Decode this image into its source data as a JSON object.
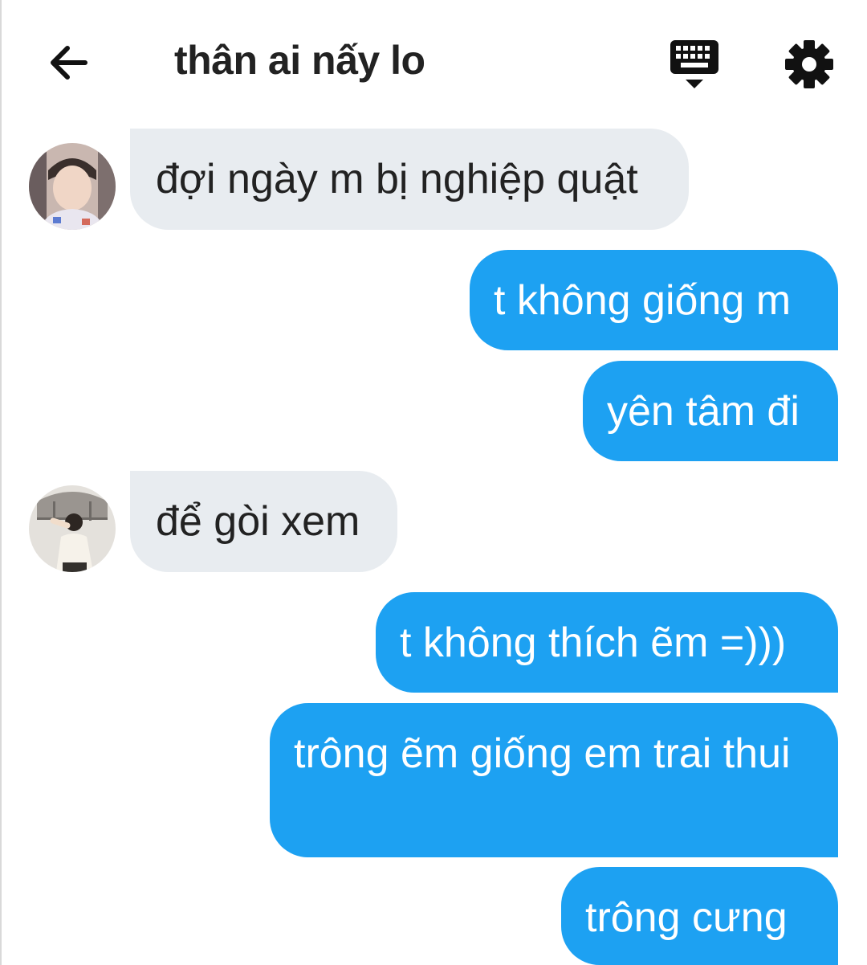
{
  "header": {
    "title": "thân ai nấy lo",
    "back_icon": "back-arrow-icon",
    "keyboard_icon": "keyboard-icon",
    "settings_icon": "gear-icon"
  },
  "messages": [
    {
      "direction": "incoming",
      "text": "đợi ngày m bị nghiệp quật",
      "avatar": "contact-avatar"
    },
    {
      "direction": "outgoing",
      "text": "t không giống m"
    },
    {
      "direction": "outgoing",
      "text": "yên tâm đi"
    },
    {
      "direction": "incoming",
      "text": "để gòi xem",
      "avatar": "contact-avatar"
    },
    {
      "direction": "outgoing",
      "text": "t không thích ẽm =)))"
    },
    {
      "direction": "outgoing",
      "text": "trông ẽm giống em trai thui"
    },
    {
      "direction": "outgoing",
      "text": "trông cưng"
    }
  ],
  "colors": {
    "outgoing_bubble": "#1da1f2",
    "incoming_bubble": "#e8ecf0",
    "title_text": "#222222"
  }
}
